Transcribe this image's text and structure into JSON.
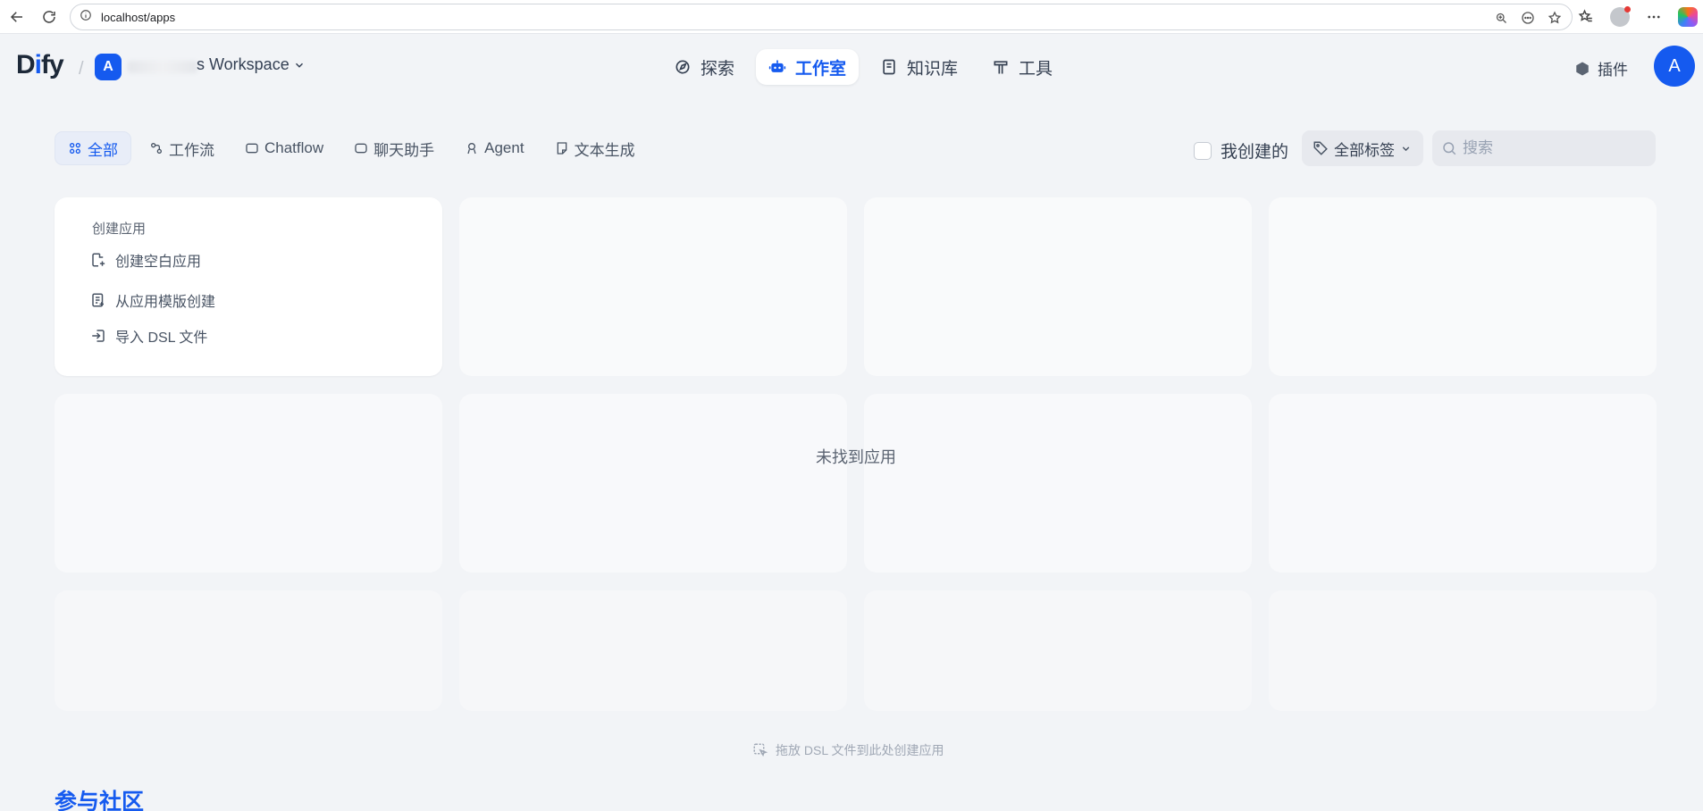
{
  "browser": {
    "url": "localhost/apps"
  },
  "header": {
    "logo": "Dify",
    "workspace_initial": "A",
    "workspace_name": "s Workspace",
    "nav": [
      {
        "label": "探索",
        "active": false
      },
      {
        "label": "工作室",
        "active": true
      },
      {
        "label": "知识库",
        "active": false
      },
      {
        "label": "工具",
        "active": false
      }
    ],
    "plugin_label": "插件",
    "user_initial": "A"
  },
  "filters": {
    "tabs": [
      {
        "label": "全部",
        "active": true
      },
      {
        "label": "工作流",
        "active": false
      },
      {
        "label": "Chatflow",
        "active": false
      },
      {
        "label": "聊天助手",
        "active": false
      },
      {
        "label": "Agent",
        "active": false
      },
      {
        "label": "文本生成",
        "active": false
      }
    ],
    "mine_label": "我创建的",
    "tag_label": "全部标签",
    "search_placeholder": "搜索"
  },
  "create_card": {
    "title": "创建应用",
    "items": [
      "创建空白应用",
      "从应用模版创建",
      "导入 DSL 文件"
    ]
  },
  "empty_message": "未找到应用",
  "drop_hint": "拖放 DSL 文件到此处创建应用",
  "community_title": "参与社区",
  "colors": {
    "accent": "#155aef",
    "background": "#f2f4f7"
  }
}
